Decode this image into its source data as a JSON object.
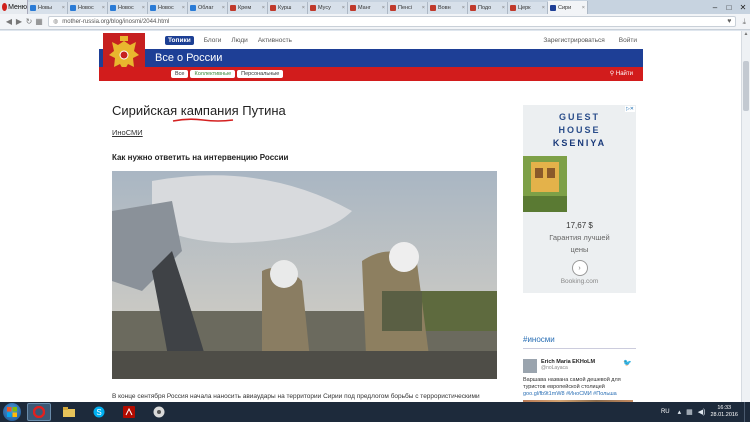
{
  "browser": {
    "menu_label": "Меню",
    "tabs": [
      {
        "label": "Новы",
        "color": "#2a7bd6"
      },
      {
        "label": "Новос",
        "color": "#2a7bd6"
      },
      {
        "label": "Новос",
        "color": "#2a7bd6"
      },
      {
        "label": "Новос",
        "color": "#2a7bd6"
      },
      {
        "label": "Облаг",
        "color": "#2a7bd6"
      },
      {
        "label": "Крем",
        "color": "#c0392b"
      },
      {
        "label": "Курш",
        "color": "#c0392b"
      },
      {
        "label": "Мусу",
        "color": "#c0392b"
      },
      {
        "label": "Манг",
        "color": "#c0392b"
      },
      {
        "label": "Пенсі",
        "color": "#c0392b"
      },
      {
        "label": "Вовн",
        "color": "#c0392b"
      },
      {
        "label": "Подо",
        "color": "#c0392b"
      },
      {
        "label": "Церк",
        "color": "#c0392b"
      },
      {
        "label": "Сири",
        "color": "#1e3f96",
        "active": true
      }
    ],
    "url": "mother-russia.org/blog/inosmi/2044.html"
  },
  "site": {
    "nav": [
      "Топики",
      "Блоги",
      "Люди",
      "Активность"
    ],
    "register": "Зарегистрироваться",
    "login": "Войти",
    "title": "Все о России",
    "filters": [
      "Все",
      "Коллективные",
      "Персональные"
    ],
    "search_label": "Найти"
  },
  "article": {
    "title_before": "Сирийская ",
    "title_mark": "кампания",
    "title_after": " Путина",
    "source": "ИноСМИ",
    "subtitle": "Как нужно ответить на интервенцию России",
    "lede": "В конце сентября Россия начала наносить авиаудары на территории Сирии под предлогом борьбы с террористическими группировками."
  },
  "ad": {
    "line1": "GUEST",
    "line2": "HOUSE",
    "line3": "KSENIYA",
    "price": "17,67 $",
    "caption1": "Гарантия лучшей",
    "caption2": "цены",
    "booking": "Booking.com"
  },
  "twitter": {
    "hashtag": "#иносми",
    "author": "Erich Maria EKHoLM",
    "handle": "@noLayaca",
    "text": "Варшава названа самой дешевой для туристов европейской столицей",
    "link": "goo.gl/fb9t1mW8 #ИноСМИ #Польша"
  },
  "taskbar": {
    "lang": "RU",
    "time": "16:33",
    "date": "28.01.2016"
  }
}
